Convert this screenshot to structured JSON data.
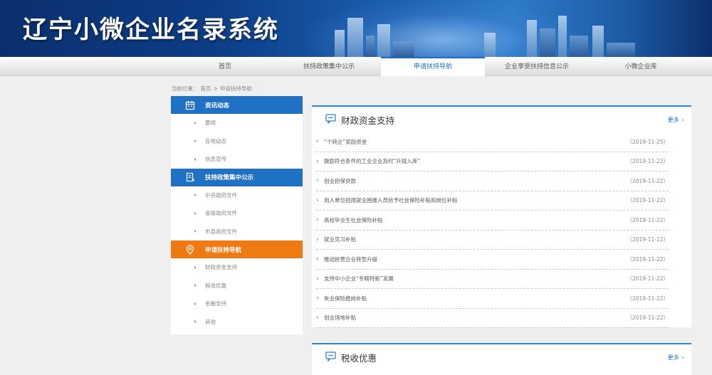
{
  "header": {
    "title": "辽宁小微企业名录系统"
  },
  "nav": {
    "items": [
      {
        "label": "首页",
        "active": false
      },
      {
        "label": "扶持政策集中公示",
        "active": false
      },
      {
        "label": "申请扶持导航",
        "active": true
      },
      {
        "label": "企业享受扶持信息公示",
        "active": false
      },
      {
        "label": "小微企业库",
        "active": false
      }
    ]
  },
  "breadcrumb": {
    "prefix": "当前位置：",
    "home": "首页",
    "sep": ">",
    "current": "申请扶持导航"
  },
  "sidebar": {
    "sections": [
      {
        "title": "资讯动态",
        "icon": "calendar-icon",
        "color": "#1f71c5",
        "items": [
          "要闻",
          "各地动态",
          "信息宣传"
        ]
      },
      {
        "title": "扶持政策集中公示",
        "icon": "document-icon",
        "color": "#1f71c5",
        "items": [
          "中央政府文件",
          "省级政府文件",
          "市县政府文件"
        ]
      },
      {
        "title": "申请扶持导航",
        "icon": "location-icon",
        "color": "#f07a12",
        "items": [
          "财政资金支持",
          "税收优惠",
          "金融支持",
          "其他"
        ]
      }
    ]
  },
  "panels": [
    {
      "title": "财政资金支持",
      "icon": "chat-icon",
      "more": "更多",
      "items": [
        {
          "text": "“个转企”奖励资金",
          "date": "（2019-11-25）"
        },
        {
          "text": "鼓励符合条件的工业企业及时“升规入库”",
          "date": "（2019-11-22）"
        },
        {
          "text": "创业担保贷款",
          "date": "（2019-11-22）"
        },
        {
          "text": "用人单位招用就业困难人员给予社会保险补贴和岗位补贴",
          "date": "（2019-11-22）"
        },
        {
          "text": "高校毕业生社会保险补贴",
          "date": "（2019-11-22）"
        },
        {
          "text": "就业见习补贴",
          "date": "（2019-11-22）"
        },
        {
          "text": "推动民营企业转型升级",
          "date": "（2019-11-22）"
        },
        {
          "text": "支持中小企业“专精特新”发展",
          "date": "（2019-11-22）"
        },
        {
          "text": "失业保险稳岗补贴",
          "date": "（2019-11-22）"
        },
        {
          "text": "创业场地补贴",
          "date": "（2019-11-22）"
        }
      ]
    },
    {
      "title": "税收优惠",
      "icon": "chat-icon",
      "more": "更多",
      "items": []
    }
  ],
  "colors": {
    "primary": "#1f71c5",
    "accent": "#f07a12",
    "panel_border": "#2d86d8"
  }
}
